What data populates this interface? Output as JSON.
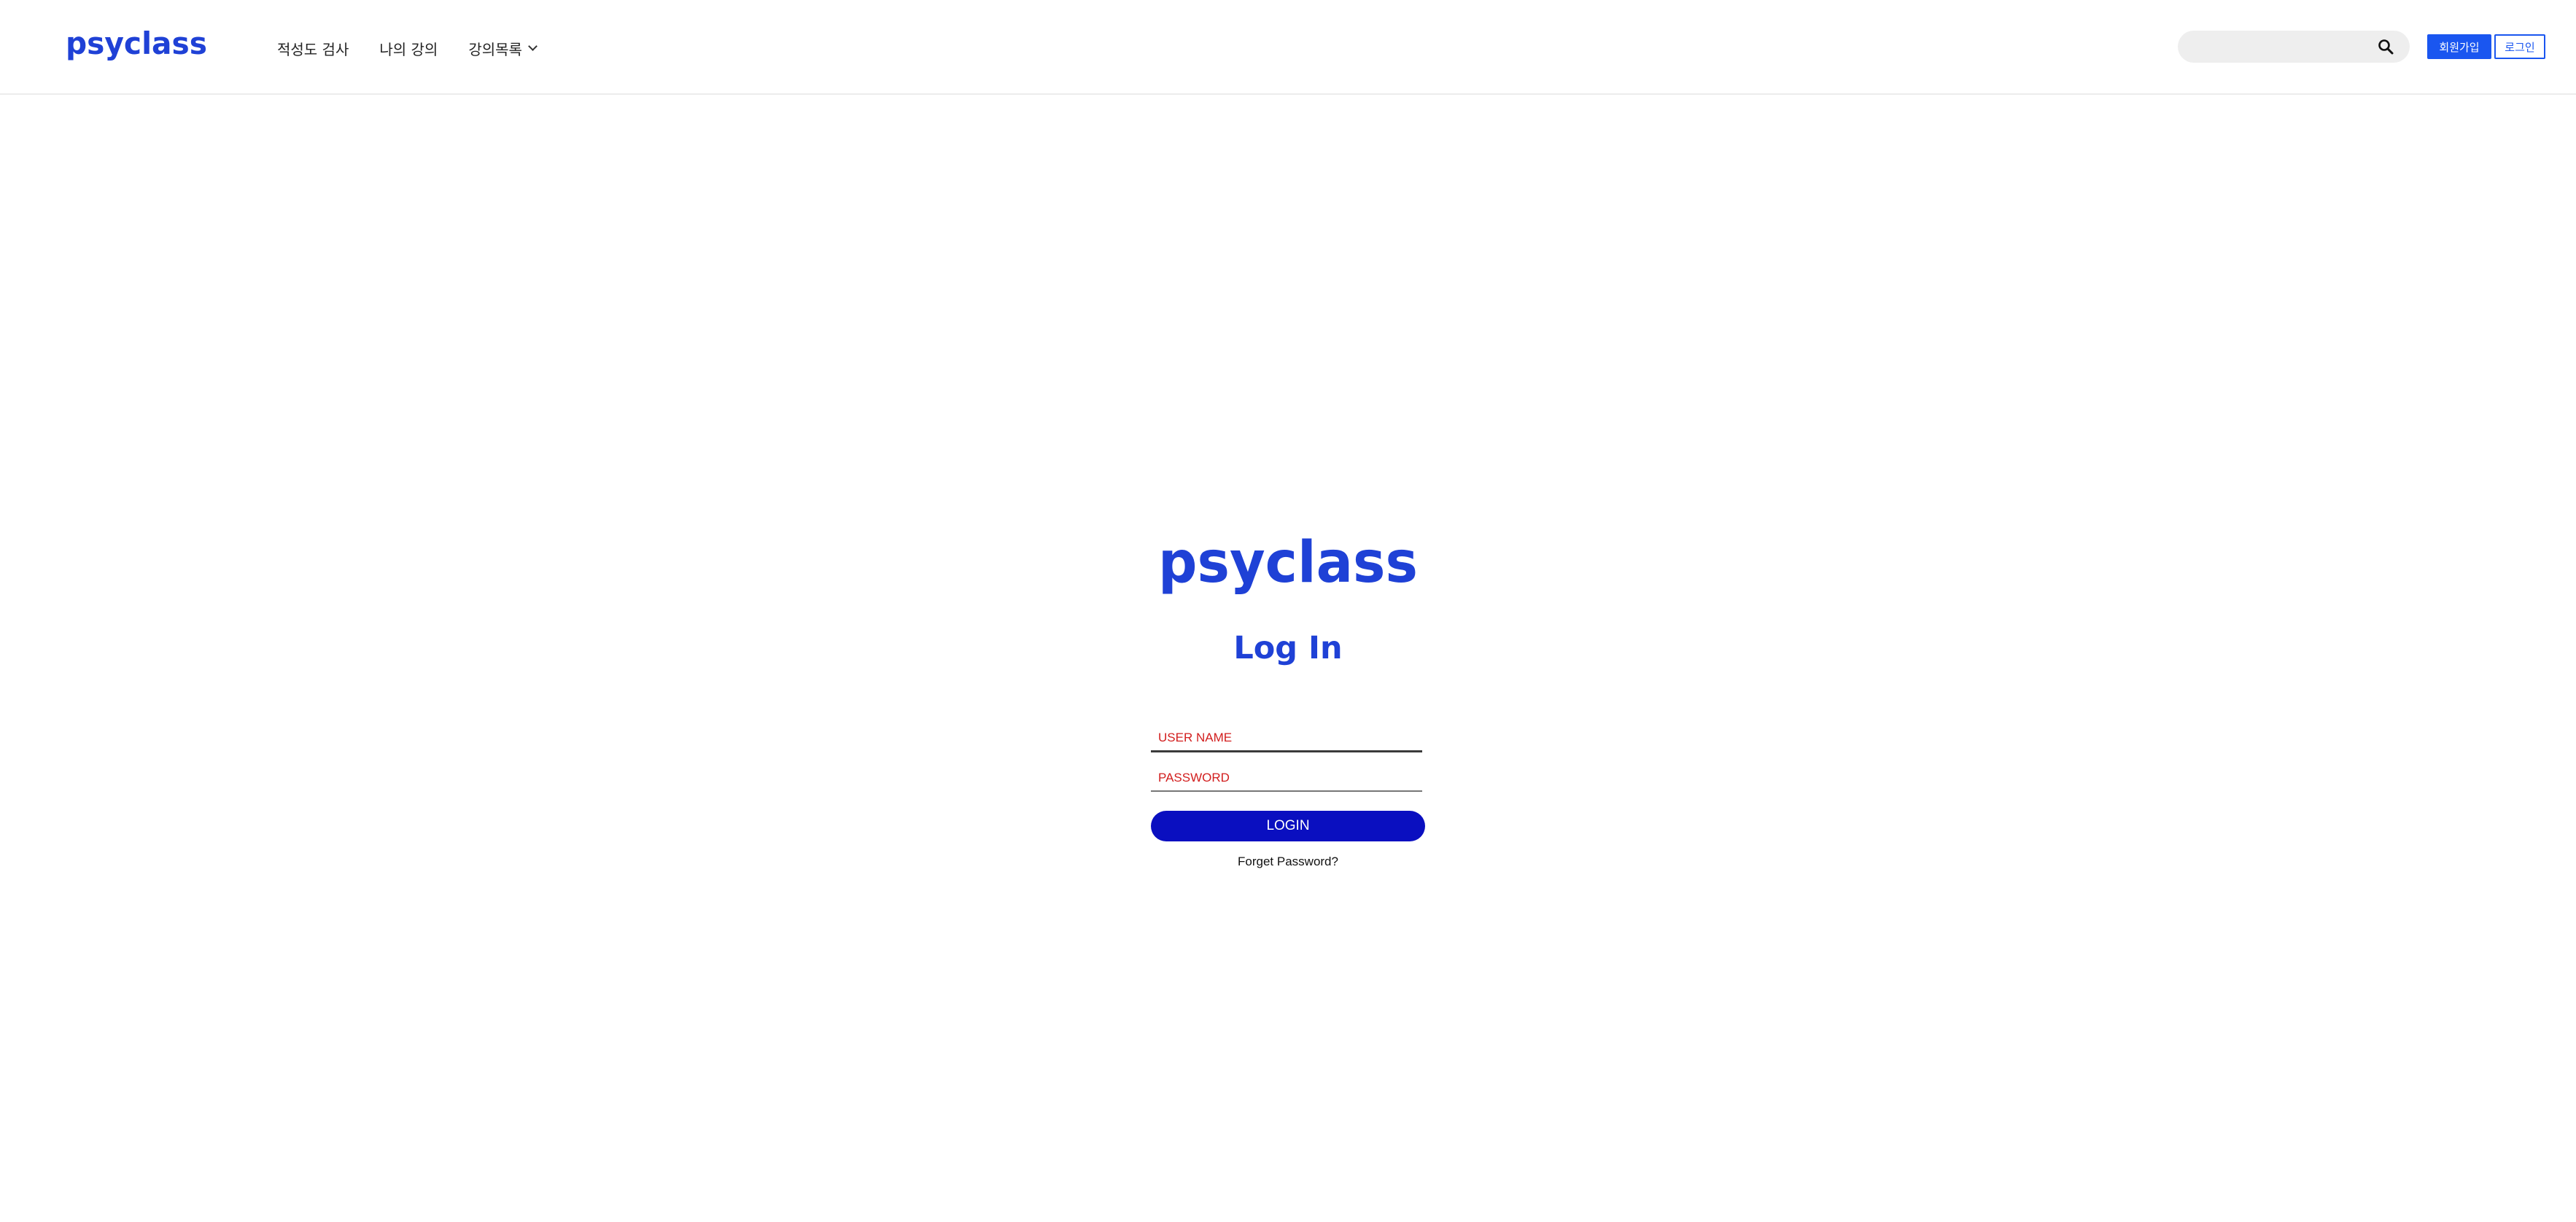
{
  "brand": {
    "name": "psyclass",
    "color": "#1f41d6"
  },
  "nav": {
    "items": [
      {
        "label": "적성도 검사"
      },
      {
        "label": "나의 강의"
      },
      {
        "label": "강의목록"
      }
    ]
  },
  "search": {
    "placeholder": "",
    "icon": "search-icon"
  },
  "header_buttons": {
    "signup_label": "회원가입",
    "login_label": "로그인"
  },
  "login": {
    "title": "Log In",
    "username_placeholder": "USER NAME",
    "password_placeholder": "PASSWORD",
    "submit_label": "LOGIN",
    "forgot_label": "Forget Password?",
    "button_color": "#0a0fc0"
  }
}
